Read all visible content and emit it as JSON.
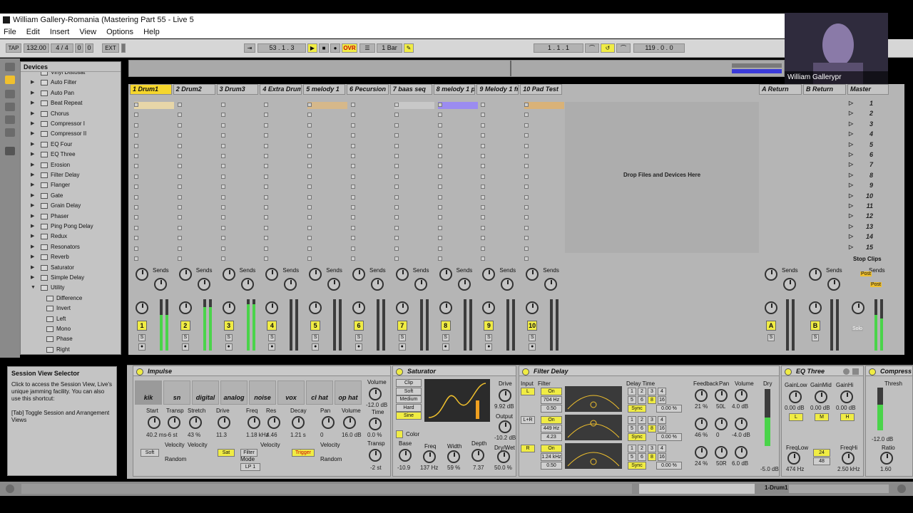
{
  "window": {
    "title": "William Gallery-Romania (Mastering Part 55 - Live 5"
  },
  "menu": [
    "File",
    "Edit",
    "Insert",
    "View",
    "Options",
    "Help"
  ],
  "transport": {
    "tap": "TAP",
    "tempo": "132.00",
    "signature": "4 / 4",
    "metro_a": "0",
    "metro_b": "0",
    "ext": "EXT",
    "position": "53 .   1 .   3",
    "ovr": "OVR",
    "quant": "1 Bar",
    "loop_start": "1 .   1 .   1",
    "loop_len": "119 .   0 .   0"
  },
  "webcam": {
    "caption": "William Gallerypr"
  },
  "browser": {
    "title": "Devices",
    "items": [
      {
        "label": "Vinyl Distosat",
        "sub": false,
        "tri": ""
      },
      {
        "label": "Auto Filter",
        "sub": false,
        "tri": "▶"
      },
      {
        "label": "Auto Pan",
        "sub": false,
        "tri": "▶"
      },
      {
        "label": "Beat Repeat",
        "sub": false,
        "tri": "▶"
      },
      {
        "label": "Chorus",
        "sub": false,
        "tri": "▶"
      },
      {
        "label": "Compressor I",
        "sub": false,
        "tri": "▶"
      },
      {
        "label": "Compressor II",
        "sub": false,
        "tri": "▶"
      },
      {
        "label": "EQ Four",
        "sub": false,
        "tri": "▶"
      },
      {
        "label": "EQ Three",
        "sub": false,
        "tri": "▶"
      },
      {
        "label": "Erosion",
        "sub": false,
        "tri": "▶"
      },
      {
        "label": "Filter Delay",
        "sub": false,
        "tri": "▶"
      },
      {
        "label": "Flanger",
        "sub": false,
        "tri": "▶"
      },
      {
        "label": "Gate",
        "sub": false,
        "tri": "▶"
      },
      {
        "label": "Grain Delay",
        "sub": false,
        "tri": "▶"
      },
      {
        "label": "Phaser",
        "sub": false,
        "tri": "▶"
      },
      {
        "label": "Ping Pong Delay",
        "sub": false,
        "tri": "▶"
      },
      {
        "label": "Redux",
        "sub": false,
        "tri": "▶"
      },
      {
        "label": "Resonators",
        "sub": false,
        "tri": "▶"
      },
      {
        "label": "Reverb",
        "sub": false,
        "tri": "▶"
      },
      {
        "label": "Saturator",
        "sub": false,
        "tri": "▶"
      },
      {
        "label": "Simple Delay",
        "sub": false,
        "tri": "▶"
      },
      {
        "label": "Utility",
        "sub": false,
        "tri": "▼"
      },
      {
        "label": "Difference",
        "sub": true,
        "tri": ""
      },
      {
        "label": "Invert",
        "sub": true,
        "tri": ""
      },
      {
        "label": "Left",
        "sub": true,
        "tri": ""
      },
      {
        "label": "Mono",
        "sub": true,
        "tri": ""
      },
      {
        "label": "Phase",
        "sub": true,
        "tri": ""
      },
      {
        "label": "Right",
        "sub": true,
        "tri": ""
      }
    ]
  },
  "session": {
    "tracks": [
      {
        "name": "1 Drum1",
        "num": "1",
        "clip_color": "#e7d6a8",
        "level": 0.7
      },
      {
        "name": "2 Drum2",
        "num": "2",
        "clip_color": "",
        "level": 0.85
      },
      {
        "name": "3 Drum3",
        "num": "3",
        "clip_color": "",
        "level": 0.9
      },
      {
        "name": "4 Extra Drum",
        "num": "4",
        "clip_color": "",
        "level": 0
      },
      {
        "name": "5 melody 1",
        "num": "5",
        "clip_color": "#d6b88a",
        "level": 0
      },
      {
        "name": "6 Pecursion",
        "num": "6",
        "clip_color": "",
        "level": 0
      },
      {
        "name": "7 baas seq",
        "num": "7",
        "clip_color": "#c8c8c8",
        "level": 0
      },
      {
        "name": "8 melody 1 p",
        "num": "8",
        "clip_color": "#9b8cf0",
        "level": 0
      },
      {
        "name": "9 Melody 1 fr",
        "num": "9",
        "clip_color": "",
        "level": 0
      },
      {
        "name": "10 Pad Test",
        "num": "10",
        "clip_color": "#d9b278",
        "level": 0
      }
    ],
    "returns": [
      {
        "name": "A Return",
        "letter": "A"
      },
      {
        "name": "B Return",
        "letter": "B"
      }
    ],
    "master": "Master",
    "scenes": [
      "1",
      "2",
      "3",
      "4",
      "5",
      "6",
      "7",
      "8",
      "9",
      "10",
      "11",
      "12",
      "13",
      "14",
      "15"
    ],
    "drop_text": "Drop Files and Devices Here",
    "sends_label": "Sends",
    "stop_clips": "Stop Clips",
    "post": "Post",
    "solo": "Solo"
  },
  "info": {
    "title": "Session View Selector",
    "text": "Click to access the Session View, Live's unique jamming facility. You can also use this shortcut:",
    "shortcut": "[Tab] Toggle Session and Arrangement Views"
  },
  "impulse": {
    "title": "Impulse",
    "pads": [
      "kik",
      "sn",
      "digital",
      "analog",
      "noise",
      "vox",
      "cl hat",
      "op hat"
    ],
    "labels": [
      "Start",
      "Transp",
      "Stretch",
      "Drive",
      "Freq",
      "Res",
      "Decay",
      "Pan",
      "Volume"
    ],
    "values": [
      "40.2 ms",
      "-6 st",
      "43 %",
      "11.3",
      "1.18 kHz",
      "4.46",
      "1.21 s",
      "0",
      "16.0 dB"
    ],
    "velocity": "Velocity",
    "random": "Random",
    "mode": "Mode",
    "soft": "Soft",
    "sat": "Sat",
    "filter": "Filter",
    "lp": "LP 1",
    "trigger": "Trigger",
    "vol_label": "Volume",
    "vol_val": "-12.0 dB",
    "time": "Time",
    "time_val": "0.0 %",
    "transp": "Transp",
    "transp_val": "-2 st"
  },
  "saturator": {
    "title": "Saturator",
    "modes": [
      "Clip",
      "Soft",
      "Medium",
      "Hard",
      "Sine"
    ],
    "drive": "Drive",
    "drive_val": "9.92 dB",
    "output": "Output",
    "output_val": "-10.2 dB",
    "color": "Color",
    "base": "Base",
    "base_val": "-10.9",
    "freq": "Freq",
    "freq_val": "137 Hz",
    "width": "Width",
    "width_val": "59 %",
    "depth": "Depth",
    "depth_val": "7.37",
    "drywet": "Dry/Wet",
    "drywet_val": "50.0 %"
  },
  "filterdelay": {
    "title": "Filter Delay",
    "input": "Input",
    "filter": "Filter",
    "on": "On",
    "rows": [
      {
        "ch": "L",
        "freq": "704 Hz",
        "q": "0.50"
      },
      {
        "ch": "L+R",
        "freq": "449 Hz",
        "q": "4.23"
      },
      {
        "ch": "R",
        "freq": "1.24 kHz",
        "q": "0.50"
      }
    ],
    "delay_time": "Delay Time",
    "sync": "Sync",
    "feedback": "Feedback",
    "pan": "Pan",
    "volume": "Volume",
    "dry": "Dry",
    "fb_vals": [
      "21 %",
      "46 %",
      "24 %"
    ],
    "pan_vals": [
      "50L",
      "0",
      "50R"
    ],
    "vol_vals": [
      "4.0 dB",
      "-4.0 dB",
      "6.0 dB"
    ],
    "dry_val": "-5.0 dB",
    "pct": "0.00 %"
  },
  "eqthree": {
    "title": "EQ Three",
    "gains": [
      "GainLow",
      "GainMid",
      "GainHi"
    ],
    "vals": [
      "0.00 dB",
      "0.00 dB",
      "0.00 dB"
    ],
    "lmh": [
      "L",
      "M",
      "H"
    ],
    "freqlow": "FreqLow",
    "freqlow_val": "474 Hz",
    "freqhi": "FreqHi",
    "freqhi_val": "2.50 kHz",
    "slope_a": "24",
    "slope_b": "48"
  },
  "compressor": {
    "title": "Compress",
    "thresh": "Thresh",
    "thresh_val": "-12.0 dB",
    "ratio": "Ratio",
    "ratio_val": "1.60"
  },
  "statusbar": {
    "track": "1-Drum1"
  }
}
